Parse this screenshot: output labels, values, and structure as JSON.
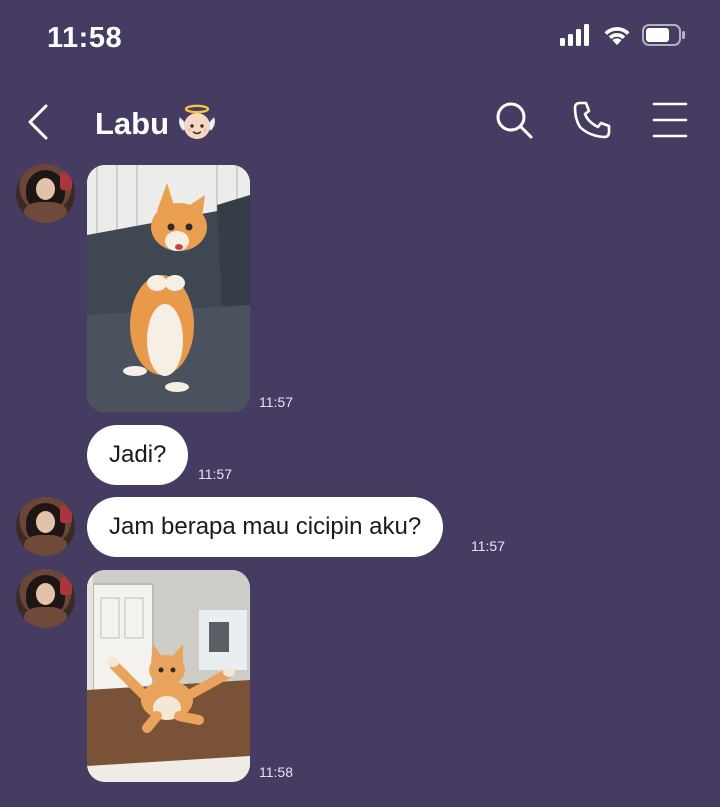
{
  "status_bar": {
    "time": "11:58",
    "icons": [
      "signal-icon",
      "wifi-icon",
      "battery-icon"
    ]
  },
  "header": {
    "title": "Labu",
    "title_emoji": "baby-angel-emoji",
    "back_icon": "chevron-left-icon",
    "actions": [
      "search-icon",
      "phone-icon",
      "menu-icon"
    ]
  },
  "colors": {
    "background": "#463c62",
    "bubble": "#ffffff",
    "bubble_text": "#1a1a1a",
    "header_text": "#ffffff"
  },
  "messages": [
    {
      "type": "image",
      "content": "standing-orange-cat-photo",
      "time": "11:57",
      "show_avatar": true
    },
    {
      "type": "text",
      "text": "Jadi?",
      "time": "11:57",
      "show_avatar": false
    },
    {
      "type": "text",
      "text": "Jam berapa mau cicipin aku?",
      "time": "11:57",
      "show_avatar": true
    },
    {
      "type": "image",
      "content": "sitting-orange-cat-on-table-photo",
      "time": "11:58",
      "show_avatar": true
    }
  ]
}
